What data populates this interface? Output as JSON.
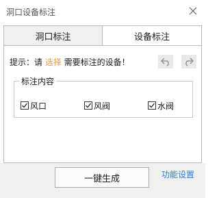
{
  "window": {
    "title": "洞口设备标注"
  },
  "tabs": [
    {
      "label": "洞口标注",
      "active": false
    },
    {
      "label": "设备标注",
      "active": true
    }
  ],
  "hint": {
    "prefix": "提示：请 ",
    "action": "选择",
    "suffix": " 需要标注的设备！"
  },
  "group": {
    "title": "标注内容",
    "options": [
      {
        "label": "风口",
        "checked": true
      },
      {
        "label": "风阀",
        "checked": true
      },
      {
        "label": "水阀",
        "checked": true
      }
    ]
  },
  "footer": {
    "generate_label": "一键生成",
    "settings_label": "功能设置"
  },
  "colors": {
    "accent_orange": "#f0a030",
    "link_blue": "#2f7dd6",
    "footer_bg": "#f0f0f0"
  }
}
